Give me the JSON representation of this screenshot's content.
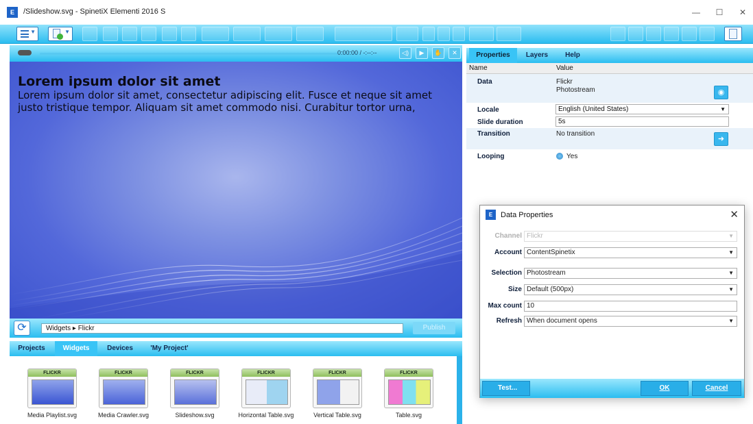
{
  "window": {
    "title": "/Slideshow.svg - SpinetiX Elementi 2016 S",
    "app_icon": "E",
    "controls": {
      "minimize": "—",
      "maximize": "☐",
      "close": "✕"
    }
  },
  "player": {
    "time": "0:00:00 / -:--:--",
    "buttons": [
      "volume-icon",
      "play-icon",
      "hand-icon",
      "close-icon"
    ]
  },
  "slide": {
    "title": "Lorem ipsum dolor sit amet",
    "body": "Lorem ipsum dolor sit amet, consectetur adipiscing elit. Fusce et neque sit amet justo tristique tempor. Aliquam sit amet commodo nisi. Curabitur tortor urna,"
  },
  "pathbar": {
    "path": "Widgets ▸ Flickr",
    "publish_label": "Publish"
  },
  "library": {
    "tabs": [
      "Projects",
      "Widgets",
      "Devices",
      "'My Project'"
    ],
    "active_tab": "Widgets",
    "items": [
      {
        "badge": "FLICKR",
        "label": "Media Playlist.svg"
      },
      {
        "badge": "FLICKR",
        "label": "Media Crawler.svg"
      },
      {
        "badge": "FLICKR",
        "label": "Slideshow.svg"
      },
      {
        "badge": "FLICKR",
        "label": "Horizontal Table.svg"
      },
      {
        "badge": "FLICKR",
        "label": "Vertical Table.svg"
      },
      {
        "badge": "FLICKR",
        "label": "Table.svg"
      }
    ]
  },
  "properties": {
    "tabs": [
      "Properties",
      "Layers",
      "Help"
    ],
    "active_tab": "Properties",
    "columns": [
      "Name",
      "Value"
    ],
    "data": {
      "name": "Data",
      "value_line1": "Flickr",
      "value_line2": "Photostream"
    },
    "locale": {
      "name": "Locale",
      "value": "English (United States)"
    },
    "slide_duration": {
      "name": "Slide duration",
      "value": "5s"
    },
    "transition": {
      "name": "Transition",
      "value": "No transition"
    },
    "looping": {
      "name": "Looping",
      "value": "Yes"
    }
  },
  "dialog": {
    "title": "Data Properties",
    "close": "✕",
    "fields": {
      "channel": {
        "label": "Channel",
        "value": "Flickr"
      },
      "account": {
        "label": "Account",
        "value": "ContentSpinetix"
      },
      "selection": {
        "label": "Selection",
        "value": "Photostream"
      },
      "size": {
        "label": "Size",
        "value": "Default (500px)"
      },
      "max_count": {
        "label": "Max count",
        "value": "10"
      },
      "refresh": {
        "label": "Refresh",
        "value": "When document opens"
      }
    },
    "buttons": {
      "test": "Test...",
      "ok": "OK",
      "cancel": "Cancel"
    }
  },
  "colors": {
    "accent": "#2bbdf0",
    "slide_bg": "#4a60d6",
    "widget_badge": "#8fbf5d"
  }
}
